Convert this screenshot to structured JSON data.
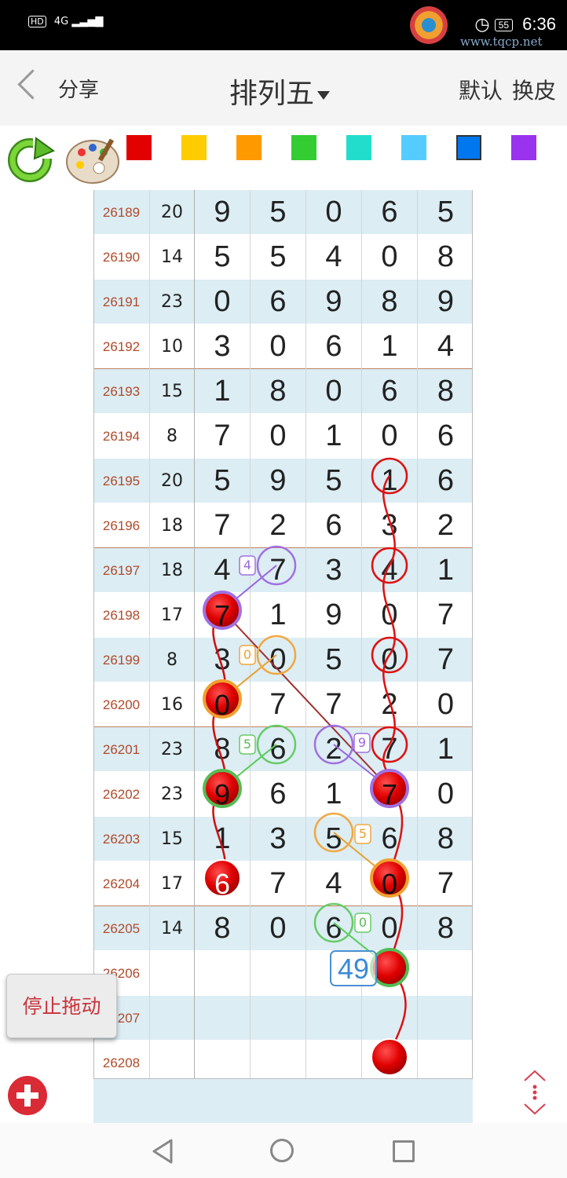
{
  "status_bar": {
    "left_badge": "HD",
    "network": "4G",
    "battery": "55",
    "time": "6:36",
    "watermark_url": "www.tqcp.net"
  },
  "header": {
    "share_label": "分享",
    "title": "排列五",
    "default_label": "默认",
    "skin_label": "换皮"
  },
  "toolbar": {
    "icons": [
      "refresh-icon",
      "palette-icon"
    ],
    "swatches": [
      "#e30000",
      "#ffcc00",
      "#ff9900",
      "#33cc33",
      "#22ddcc",
      "#55ccff",
      "#0077ee",
      "#9933ee"
    ]
  },
  "table": {
    "rows": [
      {
        "issue": "26189",
        "sum": "20",
        "digits": [
          "9",
          "5",
          "0",
          "6",
          "5"
        ]
      },
      {
        "issue": "26190",
        "sum": "14",
        "digits": [
          "5",
          "5",
          "4",
          "0",
          "8"
        ]
      },
      {
        "issue": "26191",
        "sum": "23",
        "digits": [
          "0",
          "6",
          "9",
          "8",
          "9"
        ]
      },
      {
        "issue": "26192",
        "sum": "10",
        "digits": [
          "3",
          "0",
          "6",
          "1",
          "4"
        ]
      },
      {
        "issue": "26193",
        "sum": "15",
        "digits": [
          "1",
          "8",
          "0",
          "6",
          "8"
        ]
      },
      {
        "issue": "26194",
        "sum": "8",
        "digits": [
          "7",
          "0",
          "1",
          "0",
          "6"
        ]
      },
      {
        "issue": "26195",
        "sum": "20",
        "digits": [
          "5",
          "9",
          "5",
          "1",
          "6"
        ]
      },
      {
        "issue": "26196",
        "sum": "18",
        "digits": [
          "7",
          "2",
          "6",
          "3",
          "2"
        ]
      },
      {
        "issue": "26197",
        "sum": "18",
        "digits": [
          "4",
          "7",
          "3",
          "4",
          "1"
        ]
      },
      {
        "issue": "26198",
        "sum": "17",
        "digits": [
          "7",
          "1",
          "9",
          "0",
          "7"
        ]
      },
      {
        "issue": "26199",
        "sum": "8",
        "digits": [
          "3",
          "0",
          "5",
          "0",
          "7"
        ]
      },
      {
        "issue": "26200",
        "sum": "16",
        "digits": [
          "0",
          "7",
          "7",
          "2",
          "0"
        ]
      },
      {
        "issue": "26201",
        "sum": "23",
        "digits": [
          "8",
          "6",
          "2",
          "7",
          "1"
        ]
      },
      {
        "issue": "26202",
        "sum": "23",
        "digits": [
          "9",
          "6",
          "1",
          "7",
          "0"
        ]
      },
      {
        "issue": "26203",
        "sum": "15",
        "digits": [
          "1",
          "3",
          "5",
          "6",
          "8"
        ]
      },
      {
        "issue": "26204",
        "sum": "17",
        "digits": [
          "6",
          "7",
          "4",
          "0",
          "7"
        ]
      },
      {
        "issue": "26205",
        "sum": "14",
        "digits": [
          "8",
          "0",
          "6",
          "0",
          "8"
        ]
      },
      {
        "issue": "26206",
        "sum": "",
        "digits": [
          "",
          "",
          "",
          "",
          ""
        ]
      },
      {
        "issue": "26207",
        "sum": "",
        "digits": [
          "",
          "",
          "",
          "",
          ""
        ]
      },
      {
        "issue": "26208",
        "sum": "",
        "digits": [
          "",
          "",
          "",
          "",
          ""
        ]
      }
    ],
    "annotations": {
      "tag_4": "4",
      "tag_0_a": "0",
      "tag_5_a": "5",
      "tag_9": "9",
      "tag_5_b": "5",
      "tag_0_b": "0",
      "label_49": "49"
    }
  },
  "stop_drag_label": "停止拖动"
}
